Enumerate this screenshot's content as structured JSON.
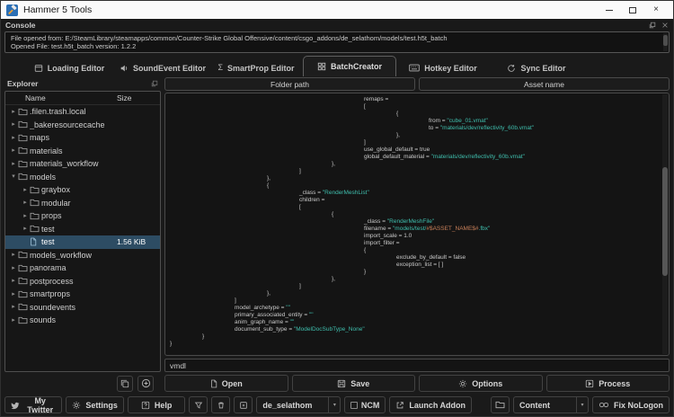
{
  "colors": {
    "string_accent": "#3fbfae",
    "macro_accent": "#c9805a",
    "selection": "#2d4c63",
    "titlebar_bg": "#fafafa",
    "window_bg": "#1a1a1a"
  },
  "icons": {
    "hammer-logo-icon": "app logo",
    "minimize-icon": "–",
    "maximize-icon": "□",
    "close-icon": "×",
    "float-panel-icon": "⧉",
    "loading-editor-icon": "▤",
    "soundevent-icon": "speaker",
    "smartprop-icon": "Σ",
    "batchcreator-icon": "⊞",
    "hotkey-icon": "keyboard",
    "sync-icon": "⟳",
    "chevron-right-icon": "▸",
    "chevron-down-icon": "▾",
    "folder-icon": "folder",
    "file-icon": "file",
    "copy-icon": "⧉",
    "add-circle-icon": "⊕",
    "open-file-icon": "file",
    "save-icon": "floppy",
    "gear-icon": "⚙",
    "process-icon": "box-play",
    "twitter-bird-icon": "bird",
    "help-icon": "?",
    "filter-icon": "funnel",
    "trash-icon": "trash",
    "box-plus-icon": "box+",
    "launch-icon": "↗",
    "rings-icon": "⚭"
  },
  "window": {
    "title": "Hammer 5 Tools"
  },
  "console": {
    "title": "Console",
    "lines": [
      "File opened from: E:/SteamLibrary/steamapps/common/Counter-Strike Global Offensive/content/csgo_addons/de_selathom/models/test.h5t_batch",
      "Opened File: test.h5t_batch version: 1.2.2"
    ]
  },
  "tabs": [
    {
      "label": "Loading Editor",
      "icon": "loading-editor-icon",
      "active": false
    },
    {
      "label": "SoundEvent Editor",
      "icon": "soundevent-icon",
      "active": false
    },
    {
      "label": "SmartProp Editor",
      "icon": "smartprop-icon",
      "active": false
    },
    {
      "label": "BatchCreator",
      "icon": "batchcreator-icon",
      "active": true
    },
    {
      "label": "Hotkey Editor",
      "icon": "hotkey-icon",
      "active": false
    },
    {
      "label": "Sync Editor",
      "icon": "sync-icon",
      "active": false
    }
  ],
  "explorer": {
    "title": "Explorer",
    "columns": [
      "Name",
      "Size"
    ],
    "items": [
      {
        "name": ".filen.trash.local",
        "kind": "folder",
        "depth": 0,
        "arrow": "right",
        "size": "",
        "selected": false
      },
      {
        "name": "_bakeresourcecache",
        "kind": "folder",
        "depth": 0,
        "arrow": "right",
        "size": "",
        "selected": false
      },
      {
        "name": "maps",
        "kind": "folder",
        "depth": 0,
        "arrow": "right",
        "size": "",
        "selected": false
      },
      {
        "name": "materials",
        "kind": "folder",
        "depth": 0,
        "arrow": "right",
        "size": "",
        "selected": false
      },
      {
        "name": "materials_workflow",
        "kind": "folder",
        "depth": 0,
        "arrow": "right",
        "size": "",
        "selected": false
      },
      {
        "name": "models",
        "kind": "folder",
        "depth": 0,
        "arrow": "down",
        "size": "",
        "selected": false
      },
      {
        "name": "graybox",
        "kind": "folder",
        "depth": 1,
        "arrow": "right",
        "size": "",
        "selected": false
      },
      {
        "name": "modular",
        "kind": "folder",
        "depth": 1,
        "arrow": "right",
        "size": "",
        "selected": false
      },
      {
        "name": "props",
        "kind": "folder",
        "depth": 1,
        "arrow": "right",
        "size": "",
        "selected": false
      },
      {
        "name": "test",
        "kind": "folder",
        "depth": 1,
        "arrow": "right",
        "size": "",
        "selected": false
      },
      {
        "name": "test",
        "kind": "file",
        "depth": 1,
        "arrow": "none",
        "size": "1.56 KiB",
        "selected": true
      },
      {
        "name": "models_workflow",
        "kind": "folder",
        "depth": 0,
        "arrow": "right",
        "size": "",
        "selected": false
      },
      {
        "name": "panorama",
        "kind": "folder",
        "depth": 0,
        "arrow": "right",
        "size": "",
        "selected": false
      },
      {
        "name": "postprocess",
        "kind": "folder",
        "depth": 0,
        "arrow": "right",
        "size": "",
        "selected": false
      },
      {
        "name": "smartprops",
        "kind": "folder",
        "depth": 0,
        "arrow": "right",
        "size": "",
        "selected": false
      },
      {
        "name": "soundevents",
        "kind": "folder",
        "depth": 0,
        "arrow": "right",
        "size": "",
        "selected": false
      },
      {
        "name": "sounds",
        "kind": "folder",
        "depth": 0,
        "arrow": "right",
        "size": "",
        "selected": false
      }
    ]
  },
  "batch": {
    "folder_path_label": "Folder path",
    "asset_name_label": "Asset name",
    "extension_value": "vmdl",
    "code_lines": [
      {
        "i": 6,
        "seg": [
          {
            "t": "remaps =",
            "c": "p"
          }
        ]
      },
      {
        "i": 6,
        "seg": [
          {
            "t": "[",
            "c": "p"
          }
        ]
      },
      {
        "i": 7,
        "seg": [
          {
            "t": "{",
            "c": "p"
          }
        ]
      },
      {
        "i": 8,
        "seg": [
          {
            "t": "from = ",
            "c": "p"
          },
          {
            "t": "\"cube_01.vmat\"",
            "c": "s"
          }
        ]
      },
      {
        "i": 8,
        "seg": [
          {
            "t": "to = ",
            "c": "p"
          },
          {
            "t": "\"materials/dev/reflectivity_60b.vmat\"",
            "c": "s"
          }
        ]
      },
      {
        "i": 7,
        "seg": [
          {
            "t": "},",
            "c": "p"
          }
        ]
      },
      {
        "i": 6,
        "seg": [
          {
            "t": "]",
            "c": "p"
          }
        ]
      },
      {
        "i": 6,
        "seg": [
          {
            "t": "use_global_default = true",
            "c": "p"
          }
        ]
      },
      {
        "i": 6,
        "seg": [
          {
            "t": "global_default_material = ",
            "c": "p"
          },
          {
            "t": "\"materials/dev/reflectivity_60b.vmat\"",
            "c": "s"
          }
        ]
      },
      {
        "i": 5,
        "seg": [
          {
            "t": "},",
            "c": "p"
          }
        ]
      },
      {
        "i": 4,
        "seg": [
          {
            "t": "]",
            "c": "p"
          }
        ]
      },
      {
        "i": 3,
        "seg": [
          {
            "t": "},",
            "c": "p"
          }
        ]
      },
      {
        "i": 3,
        "seg": [
          {
            "t": "{",
            "c": "p"
          }
        ]
      },
      {
        "i": 4,
        "seg": [
          {
            "t": "_class = ",
            "c": "p"
          },
          {
            "t": "\"RenderMeshList\"",
            "c": "s"
          }
        ]
      },
      {
        "i": 4,
        "seg": [
          {
            "t": "children =",
            "c": "p"
          }
        ]
      },
      {
        "i": 4,
        "seg": [
          {
            "t": "[",
            "c": "p"
          }
        ]
      },
      {
        "i": 5,
        "seg": [
          {
            "t": "{",
            "c": "p"
          }
        ]
      },
      {
        "i": 6,
        "seg": [
          {
            "t": "_class = ",
            "c": "p"
          },
          {
            "t": "\"RenderMeshFile\"",
            "c": "s"
          }
        ]
      },
      {
        "i": 6,
        "seg": [
          {
            "t": "filename = ",
            "c": "p"
          },
          {
            "t": "\"models/test/",
            "c": "s"
          },
          {
            "t": "#$ASSET_NAME$#",
            "c": "m"
          },
          {
            "t": ".fbx\"",
            "c": "s"
          }
        ]
      },
      {
        "i": 6,
        "seg": [
          {
            "t": "import_scale = 1.0",
            "c": "p"
          }
        ]
      },
      {
        "i": 6,
        "seg": [
          {
            "t": "import_filter =",
            "c": "p"
          }
        ]
      },
      {
        "i": 6,
        "seg": [
          {
            "t": "{",
            "c": "p"
          }
        ]
      },
      {
        "i": 7,
        "seg": [
          {
            "t": "exclude_by_default = false",
            "c": "p"
          }
        ]
      },
      {
        "i": 7,
        "seg": [
          {
            "t": "exception_list = [ ]",
            "c": "p"
          }
        ]
      },
      {
        "i": 6,
        "seg": [
          {
            "t": "}",
            "c": "p"
          }
        ]
      },
      {
        "i": 5,
        "seg": [
          {
            "t": "},",
            "c": "p"
          }
        ]
      },
      {
        "i": 4,
        "seg": [
          {
            "t": "]",
            "c": "p"
          }
        ]
      },
      {
        "i": 3,
        "seg": [
          {
            "t": "},",
            "c": "p"
          }
        ]
      },
      {
        "i": 2,
        "seg": [
          {
            "t": "]",
            "c": "p"
          }
        ]
      },
      {
        "i": 2,
        "seg": [
          {
            "t": "model_archetype = ",
            "c": "p"
          },
          {
            "t": "\"\"",
            "c": "s"
          }
        ]
      },
      {
        "i": 2,
        "seg": [
          {
            "t": "primary_associated_entity = ",
            "c": "p"
          },
          {
            "t": "\"\"",
            "c": "s"
          }
        ]
      },
      {
        "i": 2,
        "seg": [
          {
            "t": "anim_graph_name = ",
            "c": "p"
          },
          {
            "t": "\"\"",
            "c": "s"
          }
        ]
      },
      {
        "i": 2,
        "seg": [
          {
            "t": "document_sub_type = ",
            "c": "p"
          },
          {
            "t": "\"ModelDocSubType_None\"",
            "c": "s"
          }
        ]
      },
      {
        "i": 1,
        "seg": [
          {
            "t": "}",
            "c": "p"
          }
        ]
      },
      {
        "i": 0,
        "seg": [
          {
            "t": "}",
            "c": "p"
          }
        ]
      }
    ]
  },
  "actions": [
    {
      "label": "Open",
      "icon": "open-file-icon"
    },
    {
      "label": "Save",
      "icon": "save-icon"
    },
    {
      "label": "Options",
      "icon": "gear-icon"
    },
    {
      "label": "Process",
      "icon": "process-icon"
    }
  ],
  "footer": {
    "my_twitter": "My Twitter",
    "settings": "Settings",
    "help": "Help",
    "addon_dropdown": "de_selathom",
    "ncm": "NCM",
    "launch_addon": "Launch Addon",
    "content_dropdown": "Content",
    "fix_nologon": "Fix NoLogon"
  }
}
